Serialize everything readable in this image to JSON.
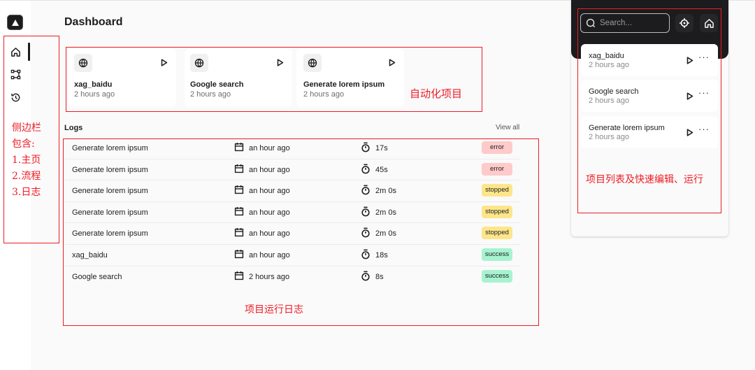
{
  "sidebar": {
    "logo_icon": "app-logo-triangle",
    "items": [
      {
        "name": "home",
        "icon": "home-icon",
        "active": true
      },
      {
        "name": "flows",
        "icon": "workflow-icon",
        "active": false
      },
      {
        "name": "history",
        "icon": "history-icon",
        "active": false
      }
    ]
  },
  "header": {
    "title": "Dashboard"
  },
  "projects": [
    {
      "name": "xag_baidu",
      "time": "2 hours ago",
      "icon": "globe-icon"
    },
    {
      "name": "Google search",
      "time": "2 hours ago",
      "icon": "globe-icon"
    },
    {
      "name": "Generate lorem ipsum",
      "time": "2 hours ago",
      "icon": "globe-icon"
    }
  ],
  "logs": {
    "title": "Logs",
    "view_all": "View all",
    "rows": [
      {
        "name": "Generate lorem ipsum",
        "date": "an hour ago",
        "duration": "17s",
        "status": "error"
      },
      {
        "name": "Generate lorem ipsum",
        "date": "an hour ago",
        "duration": "45s",
        "status": "error"
      },
      {
        "name": "Generate lorem ipsum",
        "date": "an hour ago",
        "duration": "2m 0s",
        "status": "stopped"
      },
      {
        "name": "Generate lorem ipsum",
        "date": "an hour ago",
        "duration": "2m 0s",
        "status": "stopped"
      },
      {
        "name": "Generate lorem ipsum",
        "date": "an hour ago",
        "duration": "2m 0s",
        "status": "stopped"
      },
      {
        "name": "xag_baidu",
        "date": "an hour ago",
        "duration": "18s",
        "status": "success"
      },
      {
        "name": "Google search",
        "date": "2 hours ago",
        "duration": "8s",
        "status": "success"
      }
    ]
  },
  "status_colors": {
    "error": "#fecaca",
    "stopped": "#fde68a",
    "success": "#a7f3d0"
  },
  "right_panel": {
    "search_placeholder": "Search...",
    "items": [
      {
        "name": "xag_baidu",
        "time": "2 hours ago"
      },
      {
        "name": "Google search",
        "time": "2 hours ago"
      },
      {
        "name": "Generate lorem ipsum",
        "time": "2 hours ago"
      }
    ],
    "more_label": "···"
  },
  "annotations": {
    "sidebar": [
      "侧边栏",
      "包含:",
      "1.主页",
      "2.流程",
      "3.日志"
    ],
    "projects": "自动化项目",
    "logs": "项目运行日志",
    "right_panel": "项目列表及快速编辑、运行"
  },
  "annotation_color": "#ee1c25"
}
